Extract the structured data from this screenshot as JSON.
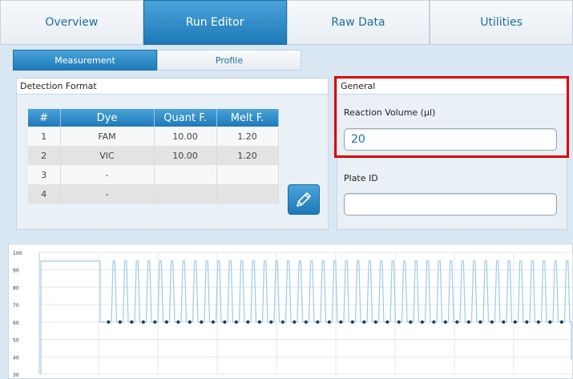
{
  "main_tabs": [
    {
      "label": "Overview",
      "active": false
    },
    {
      "label": "Run Editor",
      "active": true
    },
    {
      "label": "Raw Data",
      "active": false
    },
    {
      "label": "Utilities",
      "active": false
    }
  ],
  "sub_tabs": [
    {
      "label": "Measurement",
      "active": true
    },
    {
      "label": "Profile",
      "active": false
    }
  ],
  "detection": {
    "title": "Detection Format",
    "headers": [
      "#",
      "Dye",
      "Quant F.",
      "Melt F."
    ],
    "rows": [
      [
        "1",
        "FAM",
        "10.00",
        "1.20"
      ],
      [
        "2",
        "VIC",
        "10.00",
        "1.20"
      ],
      [
        "3",
        "-",
        "",
        ""
      ],
      [
        "4",
        "-",
        "",
        ""
      ]
    ],
    "edit_icon": "pencil-icon"
  },
  "general": {
    "title": "General",
    "reaction_volume_label": "Reaction Volume (µl)",
    "reaction_volume_value": "20",
    "plate_id_label": "Plate ID",
    "plate_id_value": ""
  },
  "colors": {
    "accent": "#1e79b9",
    "highlight": "#e00000",
    "profile_line": "#9ccbe6",
    "marker": "#1f3f63"
  },
  "chart_data": {
    "type": "line",
    "y_ticks": [
      100,
      90,
      80,
      70,
      60,
      50,
      40,
      30
    ],
    "ylim": [
      30,
      100
    ],
    "grid": true,
    "series": [
      {
        "hold_value": 95,
        "high_value": 95,
        "low_value": 60,
        "cycles": 40,
        "marker_at": "low"
      }
    ]
  }
}
